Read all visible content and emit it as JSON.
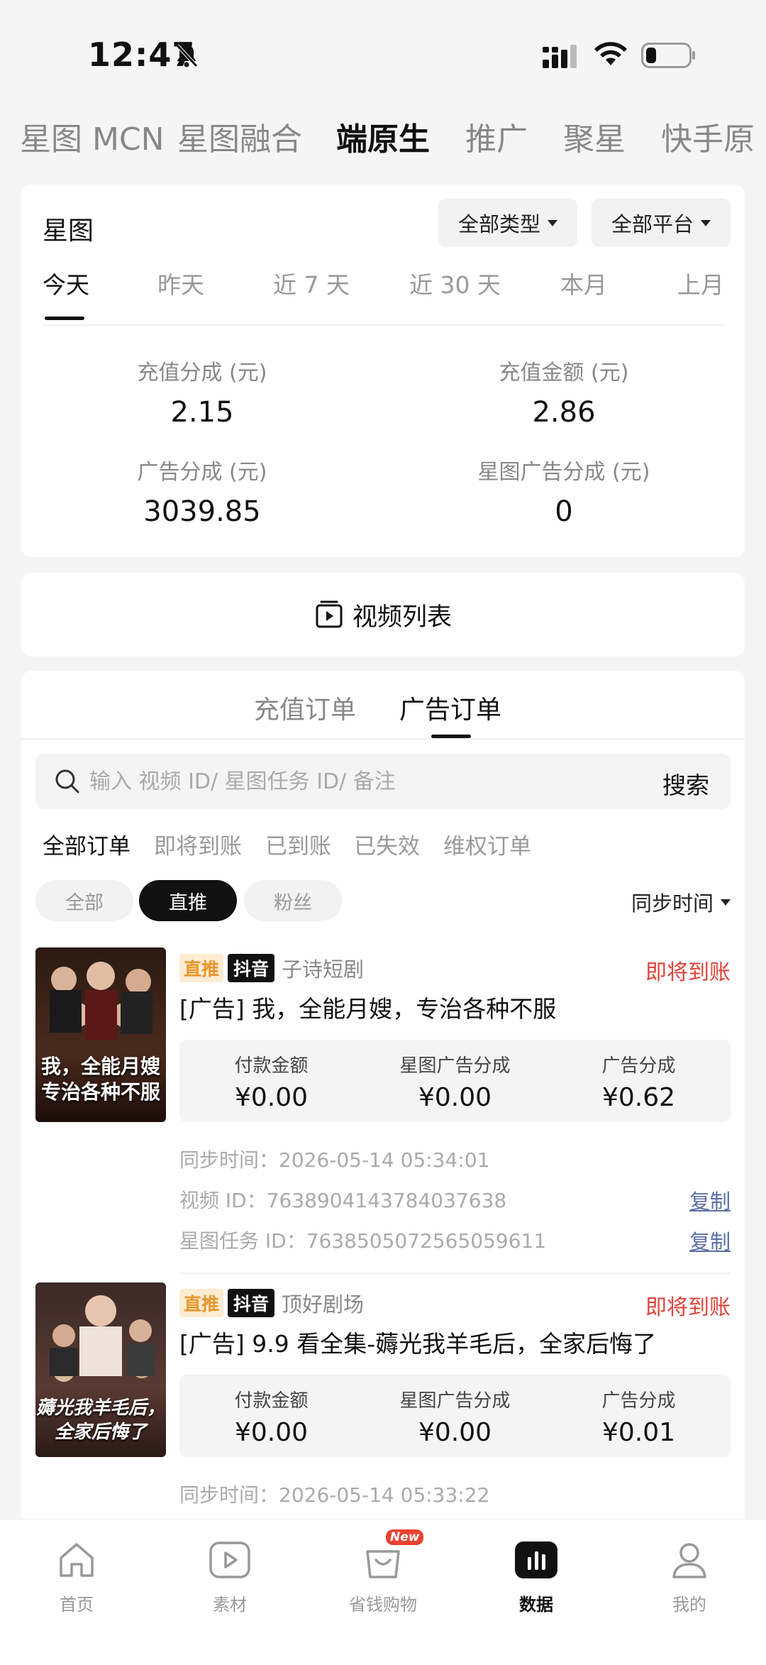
{
  "status_bar": {
    "time": "12:47"
  },
  "top_tabs": [
    "星图 MCN",
    "星图融合",
    "端原生",
    "推广",
    "聚星",
    "快手原"
  ],
  "summary": {
    "title": "星图",
    "filter_type": "全部类型",
    "filter_platform": "全部平台",
    "date_tabs": [
      "今天",
      "昨天",
      "近 7 天",
      "近 30 天",
      "本月",
      "上月"
    ],
    "stats": [
      {
        "label": "充值分成 (元)",
        "value": "2.15"
      },
      {
        "label": "充值金额 (元)",
        "value": "2.86"
      },
      {
        "label": "广告分成 (元)",
        "value": "3039.85"
      },
      {
        "label": "星图广告分成 (元)",
        "value": "0"
      }
    ]
  },
  "video_list": {
    "label": "视频列表"
  },
  "orders": {
    "type_tabs": [
      "充值订单",
      "广告订单"
    ],
    "search_placeholder": "输入 视频 ID/ 星图任务 ID/ 备注",
    "search_button": "搜索",
    "status_filters": [
      "全部订单",
      "即将到账",
      "已到账",
      "已失效",
      "维权订单"
    ],
    "chips": [
      "全部",
      "直推",
      "粉丝"
    ],
    "sort_label": "同步时间",
    "amount_labels": [
      "付款金额",
      "星图广告分成",
      "广告分成"
    ],
    "copy_label": "复制",
    "items": [
      {
        "tag": "直推",
        "platform": "抖音",
        "source": "子诗短剧",
        "status": "即将到账",
        "title": "[广告] 我，全能月嫂，专治各种不服",
        "pay": "¥0.00",
        "star_share": "¥0.00",
        "ad_share": "¥0.62",
        "sync_time": "同步时间：2026-05-14 05:34:01",
        "video_id": "视频 ID：7638904143784037638",
        "task_id": "星图任务 ID：7638505072565059611",
        "poster_text": [
          "我，全能月嫂",
          "专治各种不服"
        ]
      },
      {
        "tag": "直推",
        "platform": "抖音",
        "source": "顶好剧场",
        "status": "即将到账",
        "title": "[广告] 9.9 看全集-薅光我羊毛后，全家后悔了",
        "pay": "¥0.00",
        "star_share": "¥0.00",
        "ad_share": "¥0.01",
        "sync_time": "同步时间：2026-05-14 05:33:22",
        "poster_text": [
          "薅光我羊毛后，",
          "全家后悔了"
        ]
      }
    ]
  },
  "bottom_nav": {
    "items": [
      "首页",
      "素材",
      "省钱购物",
      "数据",
      "我的"
    ],
    "badge": "New"
  },
  "colors": {
    "status_red": "#e0433b",
    "copy_link": "#5b6fa5",
    "tag_direct_bg": "#fdecd2",
    "tag_direct_text": "#e8962b"
  }
}
